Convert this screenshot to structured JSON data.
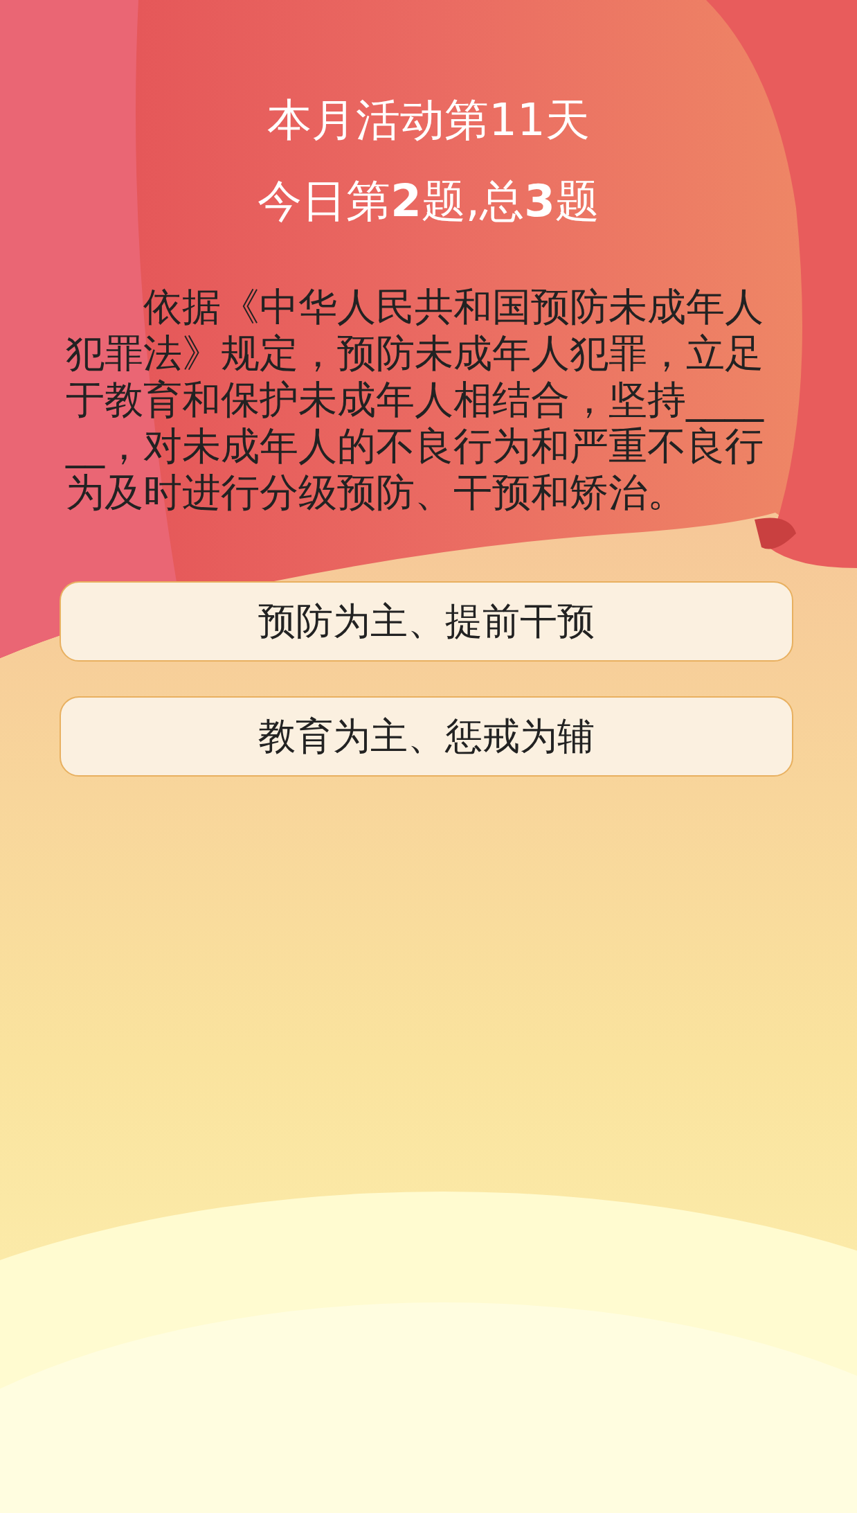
{
  "header": {
    "title": "本月活动第11天",
    "progress": "今日第**2**题,总**3**题"
  },
  "question": {
    "text": "依据《中华人民共和国预防未成年人犯罪法》规定，预防未成年人犯罪，立足于教育和保护未成年人相结合，坚持______，对未成年人的不良行为和严重不良行为及时进行分级预防、干预和矫治。"
  },
  "options": [
    {
      "label": "预防为主、提前干预"
    },
    {
      "label": "教育为主、惩戒为辅"
    }
  ]
}
